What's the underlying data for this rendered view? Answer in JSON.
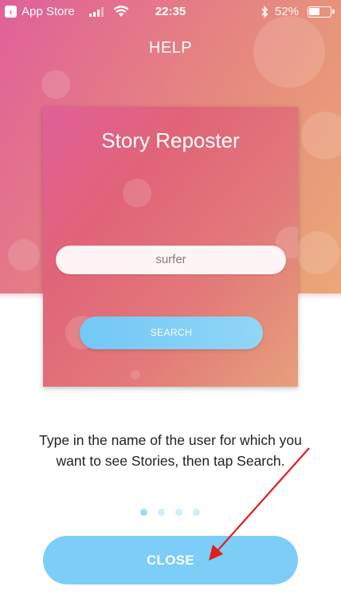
{
  "status_bar": {
    "back_app": "App Store",
    "time": "22:35",
    "battery_percent": "52%",
    "battery_level": 0.52,
    "icons": [
      "back-chevron-icon",
      "signal-icon",
      "wifi-icon",
      "bluetooth-icon",
      "battery-icon"
    ]
  },
  "header": {
    "title": "HELP"
  },
  "preview": {
    "app_title": "Story Reposter",
    "search_input_value": "surfer",
    "search_button_label": "SEARCH"
  },
  "instructions": {
    "text": "Type in the name of the user for which you want to see Stories, then tap Search."
  },
  "pagination": {
    "total": 4,
    "current": 1
  },
  "footer": {
    "close_label": "CLOSE"
  },
  "colors": {
    "accent": "#7ccdf8",
    "gradient_start": "#e0609a",
    "gradient_end": "#eaa778",
    "annotation": "#e01e1e"
  }
}
